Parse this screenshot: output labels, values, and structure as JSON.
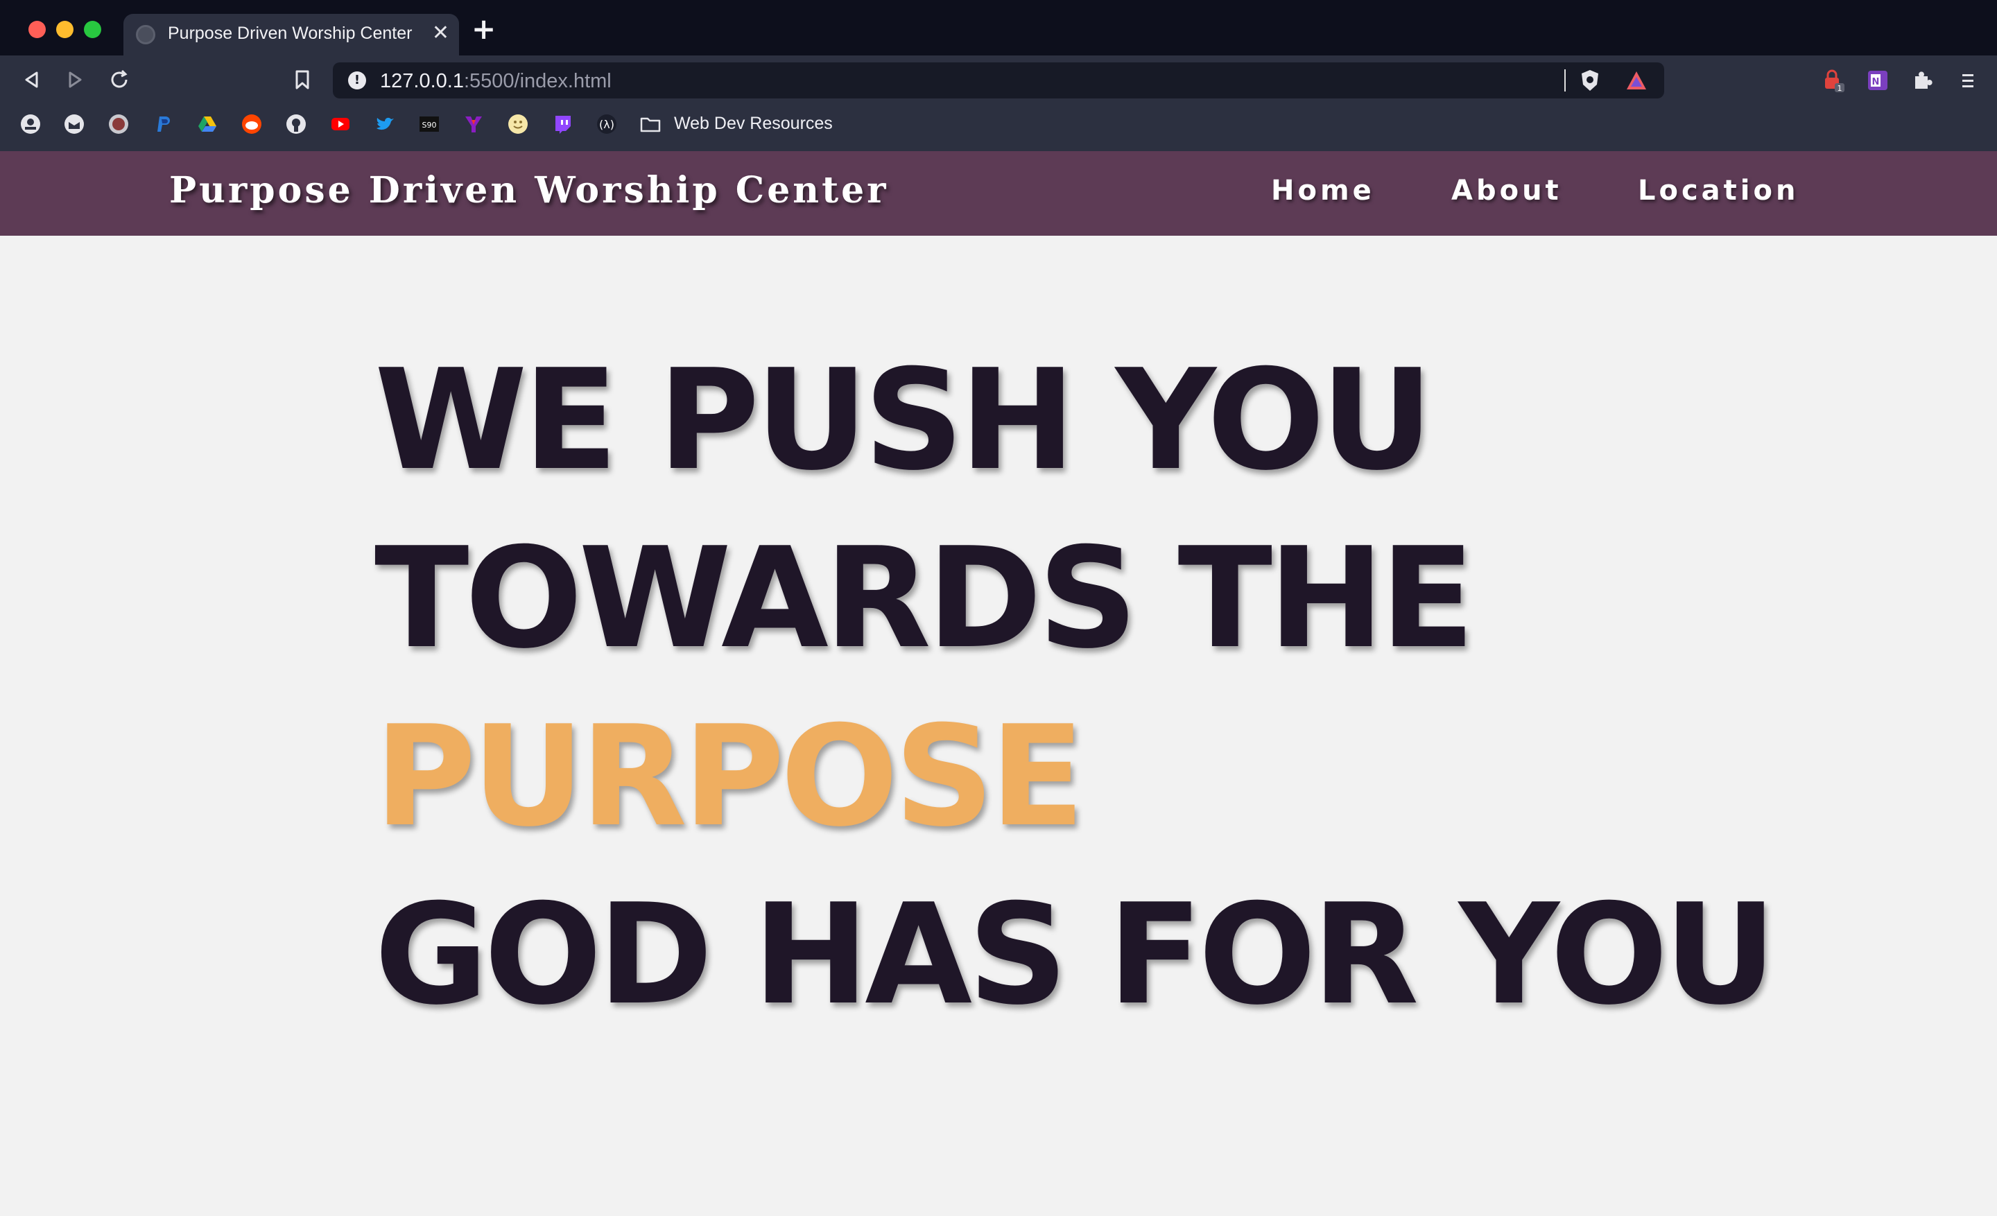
{
  "browser": {
    "tab": {
      "title": "Purpose Driven Worship Center",
      "close_glyph": "✕"
    },
    "new_tab_glyph": "+",
    "address": {
      "host": "127.0.0.1",
      "path": ":5500/index.html"
    },
    "bookmarks": {
      "icons": [
        "profile-icon",
        "mail-icon",
        "stoltz-icon",
        "paypal-icon",
        "google-drive-icon",
        "reddit-icon",
        "github-icon",
        "youtube-icon",
        "twitter-icon",
        "s90-icon",
        "yahoo-icon",
        "emoji-icon",
        "twitch-icon",
        "lambda-icon"
      ],
      "folder_label": "Web Dev Resources"
    },
    "extension_badge": "1"
  },
  "site": {
    "brand": "Purpose Driven Worship Center",
    "nav": {
      "home": "Home",
      "about": "About",
      "location": "Location"
    },
    "hero": {
      "line1": "WE PUSH YOU",
      "line2": "TOWARDS THE",
      "line3": "PURPOSE",
      "line4": "GOD HAS FOR YOU"
    }
  },
  "colors": {
    "nav_bg": "#5d3b55",
    "hero_text": "#1f1628",
    "accent": "#efae60",
    "page_bg": "#f2f2f2"
  }
}
